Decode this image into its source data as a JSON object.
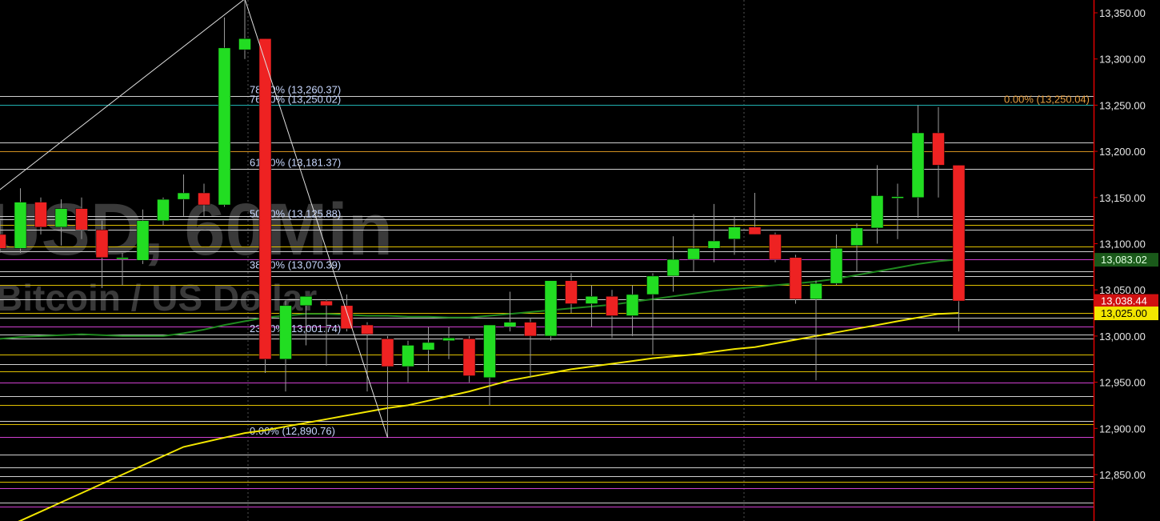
{
  "watermark": {
    "line1": "USD, 60Min",
    "line2": "Bitcoin / US Dollar"
  },
  "colors": {
    "background": "#000000",
    "up": "#22dd22",
    "down": "#ee2222",
    "price_axis": "#dd0000",
    "ma_green": "#1f8a1f",
    "ma_yellow": "#f2e600",
    "zigzag": "#e0e0e0"
  },
  "chart_data": {
    "type": "candlestick",
    "title": "",
    "xlabel": "",
    "ylabel": "",
    "ylim": [
      12810,
      13368
    ],
    "y_ticks": [
      "12,850.00",
      "12,900.00",
      "12,950.00",
      "13,000.00",
      "13,050.00",
      "13,100.00",
      "13,150.00",
      "13,200.00",
      "13,250.00",
      "13,300.00",
      "13,350.00"
    ],
    "y_tick_values": [
      12850,
      12900,
      12950,
      13000,
      13050,
      13100,
      13150,
      13200,
      13250,
      13300,
      13350
    ],
    "candles": [
      {
        "o": 13110,
        "h": 13125,
        "l": 13090,
        "c": 13095
      },
      {
        "o": 13095,
        "h": 13160,
        "l": 13090,
        "c": 13145
      },
      {
        "o": 13145,
        "h": 13150,
        "l": 13110,
        "c": 13118
      },
      {
        "o": 13118,
        "h": 13148,
        "l": 13098,
        "c": 13138
      },
      {
        "o": 13138,
        "h": 13150,
        "l": 13105,
        "c": 13115
      },
      {
        "o": 13115,
        "h": 13125,
        "l": 13052,
        "c": 13085
      },
      {
        "o": 13085,
        "h": 13090,
        "l": 13055,
        "c": 13085
      },
      {
        "o": 13082,
        "h": 13137,
        "l": 13078,
        "c": 13125
      },
      {
        "o": 13125,
        "h": 13150,
        "l": 13120,
        "c": 13148
      },
      {
        "o": 13148,
        "h": 13175,
        "l": 13130,
        "c": 13155
      },
      {
        "o": 13155,
        "h": 13165,
        "l": 13130,
        "c": 13142
      },
      {
        "o": 13142,
        "h": 13345,
        "l": 13140,
        "c": 13312
      },
      {
        "o": 13310,
        "h": 13365,
        "l": 13300,
        "c": 13322
      },
      {
        "o": 13322,
        "h": 13322,
        "l": 12960,
        "c": 12975
      },
      {
        "o": 12975,
        "h": 13038,
        "l": 12940,
        "c": 13033
      },
      {
        "o": 13033,
        "h": 13040,
        "l": 12990,
        "c": 13043
      },
      {
        "o": 13038,
        "h": 13040,
        "l": 12968,
        "c": 13033
      },
      {
        "o": 13033,
        "h": 13045,
        "l": 13005,
        "c": 13008
      },
      {
        "o": 13012,
        "h": 13015,
        "l": 12940,
        "c": 13002
      },
      {
        "o": 12997,
        "h": 13000,
        "l": 12890,
        "c": 12967
      },
      {
        "o": 12967,
        "h": 12995,
        "l": 12950,
        "c": 12990
      },
      {
        "o": 12985,
        "h": 13010,
        "l": 12962,
        "c": 12993
      },
      {
        "o": 12995,
        "h": 13010,
        "l": 12975,
        "c": 12998
      },
      {
        "o": 12997,
        "h": 13000,
        "l": 12950,
        "c": 12957
      },
      {
        "o": 12955,
        "h": 13010,
        "l": 12925,
        "c": 13012
      },
      {
        "o": 13010,
        "h": 13048,
        "l": 13005,
        "c": 13015
      },
      {
        "o": 13015,
        "h": 13020,
        "l": 12955,
        "c": 13000
      },
      {
        "o": 13000,
        "h": 13060,
        "l": 12995,
        "c": 13060
      },
      {
        "o": 13060,
        "h": 13068,
        "l": 13025,
        "c": 13035
      },
      {
        "o": 13035,
        "h": 13055,
        "l": 13010,
        "c": 13043
      },
      {
        "o": 13043,
        "h": 13050,
        "l": 12998,
        "c": 13022
      },
      {
        "o": 13022,
        "h": 13055,
        "l": 13000,
        "c": 13045
      },
      {
        "o": 13045,
        "h": 13068,
        "l": 12980,
        "c": 13065
      },
      {
        "o": 13065,
        "h": 13108,
        "l": 13048,
        "c": 13083
      },
      {
        "o": 13083,
        "h": 13132,
        "l": 13070,
        "c": 13095
      },
      {
        "o": 13095,
        "h": 13143,
        "l": 13080,
        "c": 13103
      },
      {
        "o": 13105,
        "h": 13130,
        "l": 13088,
        "c": 13118
      },
      {
        "o": 13118,
        "h": 13155,
        "l": 13110,
        "c": 13110
      },
      {
        "o": 13110,
        "h": 13112,
        "l": 13080,
        "c": 13083
      },
      {
        "o": 13085,
        "h": 13088,
        "l": 13035,
        "c": 13040
      },
      {
        "o": 13040,
        "h": 13060,
        "l": 12952,
        "c": 13057
      },
      {
        "o": 13057,
        "h": 13110,
        "l": 13055,
        "c": 13095
      },
      {
        "o": 13098,
        "h": 13122,
        "l": 13070,
        "c": 13117
      },
      {
        "o": 13117,
        "h": 13185,
        "l": 13100,
        "c": 13152
      },
      {
        "o": 13151,
        "h": 13165,
        "l": 13105,
        "c": 13151
      },
      {
        "o": 13150,
        "h": 13250,
        "l": 13128,
        "c": 13220
      },
      {
        "o": 13220,
        "h": 13248,
        "l": 13150,
        "c": 13185
      },
      {
        "o": 13185,
        "h": 13185,
        "l": 13005,
        "c": 13038
      }
    ],
    "moving_averages": [
      {
        "name": "",
        "color": "#1f8a1f",
        "values": [
          12997,
          12999,
          13000,
          13001,
          13002,
          13001,
          13000,
          13000,
          13000,
          13003,
          13007,
          13012,
          13016,
          13020,
          13022,
          13024,
          13024,
          13023,
          13022,
          13022,
          13021,
          13021,
          13020,
          13020,
          13022,
          13024,
          13026,
          13028,
          13030,
          13032,
          13034,
          13037,
          13040,
          13043,
          13046,
          13049,
          13051,
          13053,
          13055,
          13057,
          13059,
          13062,
          13066,
          13070,
          13074,
          13078,
          13081,
          13083
        ]
      },
      {
        "name": "",
        "color": "#f2e600",
        "values": [
          12790,
          12800,
          12810,
          12820,
          12830,
          12840,
          12850,
          12860,
          12870,
          12880,
          12885,
          12890,
          12895,
          12898,
          12902,
          12906,
          12910,
          12914,
          12918,
          12922,
          12925,
          12930,
          12935,
          12940,
          12946,
          12952,
          12956,
          12960,
          12964,
          12967,
          12970,
          12973,
          12976,
          12978,
          12980,
          12983,
          12986,
          12988,
          12992,
          12996,
          13000,
          13004,
          13008,
          13012,
          13016,
          13020,
          13024,
          13025
        ]
      }
    ],
    "fib_levels": [
      {
        "label": "78.60% (13,260.37)",
        "value": 13260.37
      },
      {
        "label": "76.40% (13,250.02)",
        "value": 13250.02
      },
      {
        "label": "61.80% (13,181.37)",
        "value": 13181.37
      },
      {
        "label": "50.00% (13,125.88)",
        "value": 13125.88
      },
      {
        "label": "38.20% (13,070.39)",
        "value": 13070.39
      },
      {
        "label": "23.60% (13,001.74)",
        "value": 13001.74
      },
      {
        "label": "0.00% (12,890.76)",
        "value": 12890.76
      }
    ],
    "fib_right": {
      "label": "0.00% (13,250.04)",
      "value": 13250.04
    },
    "zigzag": [
      {
        "candle": -0.5,
        "value": 13150
      },
      {
        "candle": 12,
        "value": 13365
      },
      {
        "candle": 19,
        "value": 12890
      }
    ],
    "horizontal_lines": [
      {
        "value": 13365,
        "color": "#c0c0c0"
      },
      {
        "value": 13260,
        "color": "#d0d0d0"
      },
      {
        "value": 13250,
        "color": "#20b0b0"
      },
      {
        "value": 13210,
        "color": "#d0d0d0"
      },
      {
        "value": 13200,
        "color": "#d09020"
      },
      {
        "value": 13181,
        "color": "#d0d0d0"
      },
      {
        "value": 13130,
        "color": "#d0d0d0"
      },
      {
        "value": 13126,
        "color": "#d0d0d0"
      },
      {
        "value": 13120,
        "color": "#e0c000"
      },
      {
        "value": 13115,
        "color": "#d0d0d0"
      },
      {
        "value": 13097,
        "color": "#e0c000"
      },
      {
        "value": 13092,
        "color": "#d0d0d0"
      },
      {
        "value": 13083,
        "color": "#d040d0"
      },
      {
        "value": 13070,
        "color": "#d0d0d0"
      },
      {
        "value": 13065,
        "color": "#d0d0d0"
      },
      {
        "value": 13055,
        "color": "#e0c000"
      },
      {
        "value": 13040,
        "color": "#d0d0d0"
      },
      {
        "value": 13025,
        "color": "#e0c000"
      },
      {
        "value": 13020,
        "color": "#d0d0d0"
      },
      {
        "value": 13010,
        "color": "#d040d0"
      },
      {
        "value": 13002,
        "color": "#d0d0d0"
      },
      {
        "value": 12997,
        "color": "#d0d0d0"
      },
      {
        "value": 12980,
        "color": "#e0c000"
      },
      {
        "value": 12970,
        "color": "#d0d0d0"
      },
      {
        "value": 12962,
        "color": "#e0c000"
      },
      {
        "value": 12950,
        "color": "#d040d0"
      },
      {
        "value": 12935,
        "color": "#d0d0d0"
      },
      {
        "value": 12925,
        "color": "#e0c000"
      },
      {
        "value": 12908,
        "color": "#d0d0d0"
      },
      {
        "value": 12905,
        "color": "#e0c000"
      },
      {
        "value": 12891,
        "color": "#d040d0"
      },
      {
        "value": 12872,
        "color": "#d0d0d0"
      },
      {
        "value": 12858,
        "color": "#d0d0d0"
      },
      {
        "value": 12848,
        "color": "#d0d0d0"
      },
      {
        "value": 12842,
        "color": "#e0c000"
      },
      {
        "value": 12835,
        "color": "#d040d0"
      },
      {
        "value": 12820,
        "color": "#d0d0d0"
      },
      {
        "value": 12815,
        "color": "#d040d0"
      }
    ],
    "price_tags": [
      {
        "label": "13,083.02",
        "value": 13083.02,
        "bg": "#1a5a1a",
        "fg": "#e0ffe0"
      },
      {
        "label": "13,038.44",
        "value": 13038.44,
        "bg": "#d01010",
        "fg": "#ffffff"
      },
      {
        "label": "13,025.00",
        "value": 13025.0,
        "bg": "#f2e600",
        "fg": "#000000"
      }
    ]
  }
}
